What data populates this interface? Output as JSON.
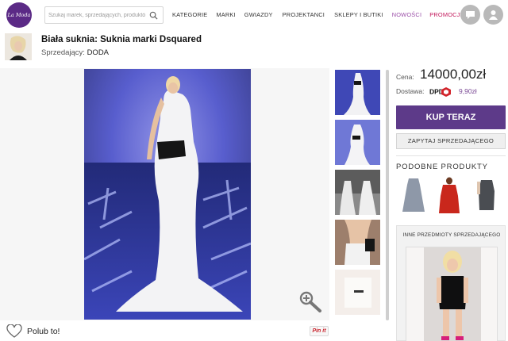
{
  "header": {
    "logo_text": "La Moda",
    "search_placeholder": "Szukaj marek, sprzedających, produktów",
    "nav": [
      "KATEGORIE",
      "MARKI",
      "GWIAZDY",
      "PROJEKTANCI",
      "SKLEPY I BUTIKI",
      "NOWOŚCI",
      "PROMOCJE"
    ]
  },
  "product": {
    "title": "Biała suknia: Suknia marki Dsquared",
    "seller_label": "Sprzedający:",
    "seller_name": "DODA"
  },
  "purchase": {
    "price_label": "Cena:",
    "price": "14000,00zł",
    "shipping_label": "Dostawa:",
    "shipping_carrier": "DPD",
    "shipping_price": "9,90zł",
    "buy_label": "KUP TERAZ",
    "ask_label": "ZAPYTAJ SPRZEDAJĄCEGO"
  },
  "similar": {
    "title": "PODOBNE PRODUKTY",
    "items": [
      "grey-dress",
      "red-dress",
      "black-dress"
    ]
  },
  "other_items": {
    "title": "INNE PRZEDMIOTY SPRZEDAJĄCEGO"
  },
  "social": {
    "like_label": "Polub to!",
    "pin_label": "Pin it"
  },
  "colors": {
    "brand_purple": "#5d3a89",
    "promo_pink": "#c2185b",
    "new_purple": "#9b4fa8"
  }
}
